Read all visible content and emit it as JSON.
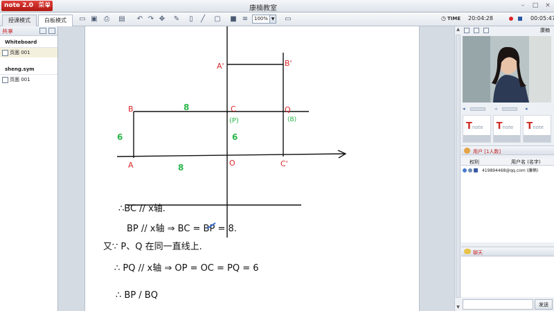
{
  "app": {
    "logo_text": "note 2.0",
    "menu_label": "菜单",
    "title": "康楠教室"
  },
  "tabs": [
    {
      "label": "授课模式"
    },
    {
      "label": "白板模式"
    }
  ],
  "toolbar": {
    "zoom": "100%",
    "time_label": "TIME",
    "clock": "20:04:28",
    "elapsed": "00:05:47"
  },
  "left_panel": {
    "header": "共享",
    "groups": [
      {
        "name": "Whiteboard",
        "items": [
          {
            "label": "页面 001"
          }
        ]
      },
      {
        "name": "sheng.sym",
        "items": [
          {
            "label": "页面 001"
          }
        ]
      }
    ]
  },
  "right_panel": {
    "teacher_name": "康楠",
    "thumb_logo": "T",
    "thumb_word": "note",
    "users_header": "用户 [1人数]",
    "columns": [
      "权利",
      "用户名 (名字)"
    ],
    "user": {
      "name": "419894468@qq.com (康楠)"
    },
    "chat_header": "聊天",
    "send_label": "发送"
  },
  "board": {
    "point_labels": [
      "A'",
      "B'",
      "B",
      "C",
      "Q",
      "(P)",
      "(B)",
      "A",
      "O",
      "C'"
    ],
    "numbers": [
      "8",
      "6",
      "6",
      "8"
    ],
    "lines": [
      "∴BC // x轴.",
      "BP // x轴 ⇒ BC = BP = 8.",
      "又∵ P、Q 在同一直线上.",
      "∴ PQ // x轴 ⇒ OP = OC = PQ = 6",
      "∴ BP / BQ"
    ]
  },
  "colors": {
    "accent": "#c21f1f",
    "ink_red": "#d7262a",
    "ink_green": "#2bb64a",
    "ink_black": "#111111"
  }
}
